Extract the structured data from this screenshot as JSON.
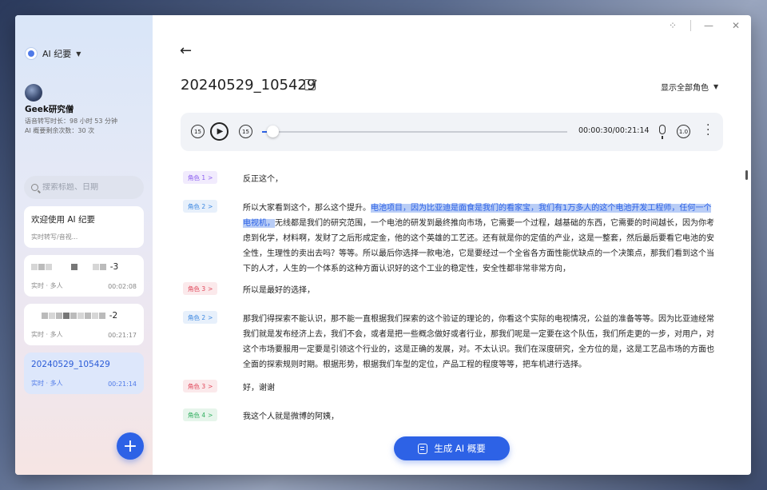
{
  "app": {
    "name": "AI 纪要"
  },
  "user": {
    "name": "Geek研究僧",
    "transcribe_quota": "语音转写时长：98 小时 53 分钟",
    "summary_quota": "AI 概要剩余次数：30 次"
  },
  "search": {
    "placeholder": "搜索标题、日期"
  },
  "records": [
    {
      "title": "欢迎使用 AI 纪要",
      "subtitle": "实时转写/音视...",
      "duration": ""
    },
    {
      "title": "-3",
      "subtitle": "实时 · 多人",
      "duration": "00:02:08"
    },
    {
      "title": "-2",
      "subtitle": "实时 · 多人",
      "duration": "00:21:17"
    },
    {
      "title": "20240529_105429",
      "subtitle": "实时 · 多人",
      "duration": "00:21:14"
    }
  ],
  "window_controls": {
    "grid": "⁘",
    "minimize": "—",
    "close": "✕"
  },
  "doc": {
    "back": "←",
    "title": "20240529_105429",
    "roles_filter": "显示全部角色"
  },
  "player": {
    "skip_back_label": "15",
    "skip_fwd_label": "15",
    "speed_label": "1.0",
    "time": "00:00:30/00:21:14",
    "progress": 0.02
  },
  "colors": {
    "accent": "#2d62e6",
    "role1": "#8a5cf0",
    "role2": "#3a86e0",
    "role3": "#e0475a",
    "role4": "#2fae5e"
  },
  "transcript": [
    {
      "role": "角色 1",
      "role_key": "role1",
      "text_before": "反正这个，",
      "highlight": "",
      "text_after": ""
    },
    {
      "role": "角色 2",
      "role_key": "role2",
      "text_before": "所以大家看到这个，那么这个提升。",
      "highlight": "电池项目，因为比亚迪是面食是我们的看家宝，我们有1万多人的这个电池开发工程师，任何一个电视机，",
      "text_after": "无线都是我们的研究范围，一个电池的研发到最终推向市场，它需要一个过程，越基础的东西，它需要的时间越长，因为你考虑到化学，材料啊，发财了之后形成定金，他的这个英雄的工艺还。还有就是你的定值的产业，这是一整套，然后最后要看它电池的安全性，生理性的卖出去吗？等等。所以最后你选择一款电池，它是要经过一个全省各方面性能优缺点的一个决策点，那我们看到这个当下的人才，人生的一个体系的这种方面认识好的这个工业的稳定性，安全性都非常非常方向，"
    },
    {
      "role": "角色 3",
      "role_key": "role3",
      "text_before": "所以是最好的选择，",
      "highlight": "",
      "text_after": ""
    },
    {
      "role": "角色 2",
      "role_key": "role2",
      "text_before": "那我们得探索不能认识，那不能一直根据我们探索的这个验证的理论的，你看这个实际的电视情况，公益的准备等等。因为比亚迪经常我们就是发布经济上去，我们不会，或者是把一些概念做好或者行业，那我们呢是一定要在这个队伍，我们所走更的一步，对用户，对这个市场要服用一定要是引领这个行业的，这是正确的发展，对。不太认识。我们在深度研究，全方位的是，这是工艺品市场的方面也全面的探索规则时期。根据形势，根据我们车型的定位，产品工程的程度等等，把车机进行选择。",
      "highlight": "",
      "text_after": ""
    },
    {
      "role": "角色 3",
      "role_key": "role3",
      "text_before": "好，谢谢",
      "highlight": "",
      "text_after": ""
    },
    {
      "role": "角色 4",
      "role_key": "role4",
      "text_before": "我这个人就是微博的阿姨，",
      "highlight": "",
      "text_after": ""
    }
  ],
  "actions": {
    "generate_summary": "生成 AI 概要",
    "new_record": "+"
  }
}
